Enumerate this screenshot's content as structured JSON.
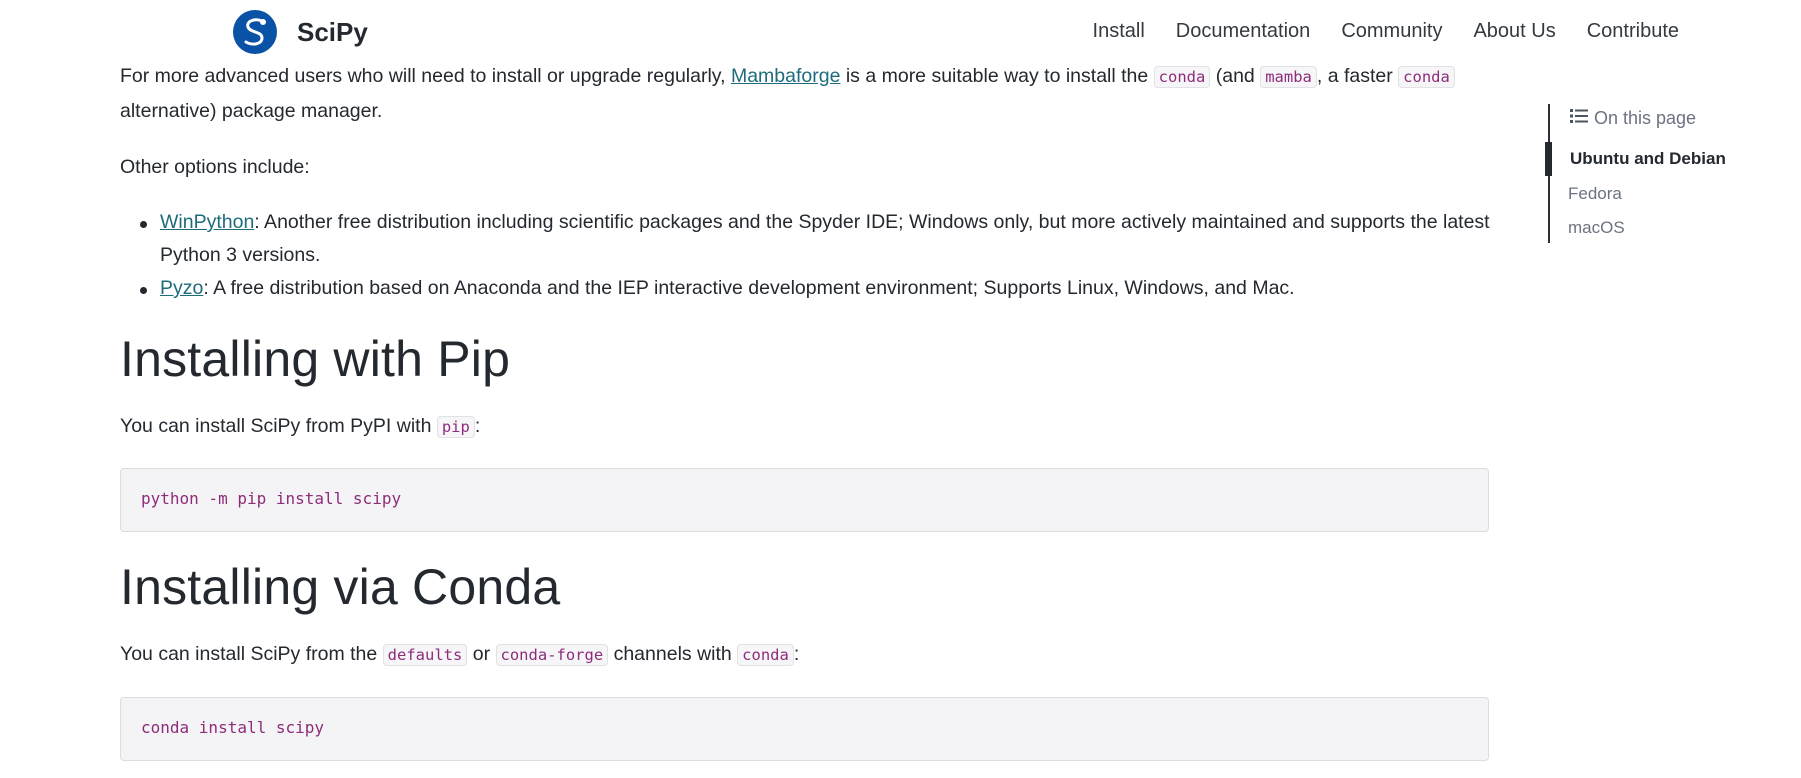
{
  "header": {
    "brand_name": "SciPy",
    "logo_icon": "scipy-logo-icon",
    "nav": [
      {
        "label": "Install"
      },
      {
        "label": "Documentation"
      },
      {
        "label": "Community"
      },
      {
        "label": "About Us"
      },
      {
        "label": "Contribute"
      }
    ]
  },
  "content": {
    "p1": {
      "t1": "For more advanced users who will need to install or upgrade regularly, ",
      "link": "Mambaforge",
      "t2": " is a more suitable way to install the ",
      "code1": "conda",
      "t3": " (and ",
      "code2": "mamba",
      "t4": ", a faster ",
      "code3": "conda",
      "t5": " alternative) package manager."
    },
    "p2": "Other options include:",
    "list": [
      {
        "link": "WinPython",
        "text": ": Another free distribution including scientific packages and the Spyder IDE; Windows only, but more actively maintained and supports the latest Python 3 versions."
      },
      {
        "link": "Pyzo",
        "text": ": A free distribution based on Anaconda and the IEP interactive development environment; Supports Linux, Windows, and Mac."
      }
    ],
    "h_pip": "Installing with Pip",
    "p3": {
      "t1": "You can install SciPy from PyPI with ",
      "code": "pip",
      "t2": ":"
    },
    "code_pip": "python -m pip install scipy",
    "h_conda": "Installing via Conda",
    "p4": {
      "t1": "You can install SciPy from the ",
      "code1": "defaults",
      "t2": " or ",
      "code2": "conda-forge",
      "t3": " channels with ",
      "code3": "conda",
      "t4": ":"
    },
    "code_conda": "conda install scipy"
  },
  "toc": {
    "title": "On this page",
    "title_icon": "list-icon",
    "items": [
      {
        "label": "Ubuntu and Debian",
        "active": true
      },
      {
        "label": "Fedora",
        "active": false
      },
      {
        "label": "macOS",
        "active": false
      }
    ]
  }
}
